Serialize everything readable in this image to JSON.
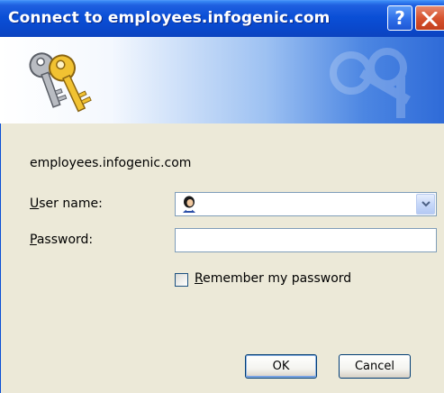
{
  "window": {
    "title": "Connect to employees.infogenic.com",
    "help_button_label": "?",
    "accent_color": "#0a4fd6",
    "close_color": "#d7532f"
  },
  "banner": {
    "icon": "keys-icon"
  },
  "form": {
    "host": "employees.infogenic.com",
    "username_label_accel": "U",
    "username_label_rest": "ser name:",
    "username_value": "",
    "password_label_accel": "P",
    "password_label_rest": "assword:",
    "password_value": "",
    "remember_accel": "R",
    "remember_rest": "emember my password",
    "remember_checked": false
  },
  "buttons": {
    "ok_label": "OK",
    "cancel_label": "Cancel"
  }
}
